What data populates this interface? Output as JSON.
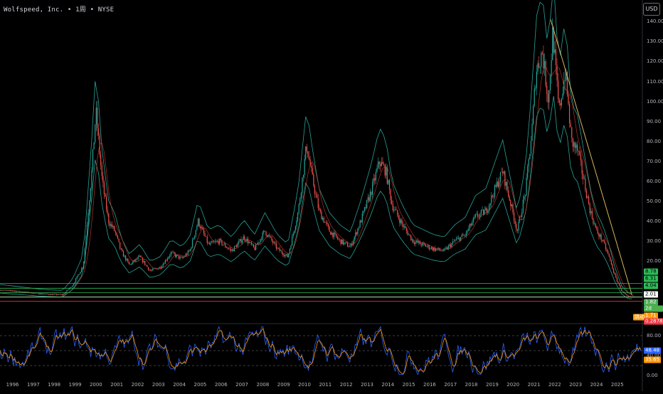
{
  "header": {
    "title": "Wolfspeed, Inc. • 1周 • NYSE",
    "currency_button": "USD"
  },
  "chart_data": [
    {
      "type": "line",
      "title": "Wolfspeed, Inc. • 1周 • NYSE",
      "price_axis": {
        "ylim": [
          -2.5,
          143
        ],
        "ticks": [
          {
            "value": 140,
            "label": "140.00"
          },
          {
            "value": 130,
            "label": "130.00"
          },
          {
            "value": 120,
            "label": "120.00"
          },
          {
            "value": 110,
            "label": "110.00"
          },
          {
            "value": 100,
            "label": "100.00"
          },
          {
            "value": 90,
            "label": "90.00"
          },
          {
            "value": 80,
            "label": "80.00"
          },
          {
            "value": 70,
            "label": "70.00"
          },
          {
            "value": 60,
            "label": "60.00"
          },
          {
            "value": 50,
            "label": "50.00"
          },
          {
            "value": 40,
            "label": "40.00"
          },
          {
            "value": 30,
            "label": "30.00"
          },
          {
            "value": 20,
            "label": "20.00"
          }
        ]
      },
      "x_axis": {
        "range": [
          1995.5,
          2026.3
        ],
        "ticks": [
          "1996",
          "1997",
          "1998",
          "1999",
          "2000",
          "2001",
          "2002",
          "2003",
          "2004",
          "2005",
          "2006",
          "2007",
          "2008",
          "2009",
          "2010",
          "2011",
          "2012",
          "2013",
          "2014",
          "2015",
          "2016",
          "2017",
          "2018",
          "2019",
          "2020",
          "2021",
          "2022",
          "2023",
          "2024",
          "2025"
        ]
      },
      "series": [
        {
          "role": "price",
          "color": "#e0707a",
          "x": [
            1995.5,
            1996.5,
            1997.5,
            1998.5,
            1999.0,
            1999.5,
            1999.9,
            2000.1,
            2000.4,
            2000.7,
            2001.0,
            2001.3,
            2001.7,
            2002.2,
            2002.7,
            2003.2,
            2003.7,
            2004.2,
            2004.6,
            2005.0,
            2005.5,
            2006.0,
            2006.6,
            2007.2,
            2007.7,
            2008.2,
            2008.8,
            2009.3,
            2009.8,
            2010.2,
            2010.5,
            2010.8,
            2011.3,
            2011.8,
            2012.3,
            2012.8,
            2013.3,
            2013.7,
            2014.0,
            2014.3,
            2014.8,
            2015.3,
            2015.8,
            2016.3,
            2016.8,
            2017.3,
            2017.8,
            2018.3,
            2018.8,
            2019.2,
            2019.6,
            2020.0,
            2020.3,
            2020.7,
            2021.0,
            2021.2,
            2021.5,
            2021.8,
            2022.0,
            2022.3,
            2022.6,
            2022.9,
            2023.2,
            2023.5,
            2023.8,
            2024.1,
            2024.4,
            2024.7,
            2025.0,
            2025.3,
            2025.6,
            2025.9
          ],
          "y": [
            5.5,
            4.5,
            3.5,
            3.0,
            8.0,
            18.0,
            65.0,
            95.0,
            60.0,
            40.0,
            35.0,
            25.0,
            18.0,
            22.0,
            15.0,
            17.0,
            24.0,
            21.0,
            25.0,
            40.0,
            28.0,
            30.0,
            25.0,
            32.0,
            26.0,
            35.0,
            26.0,
            22.0,
            45.0,
            78.0,
            60.0,
            45.0,
            35.0,
            30.0,
            27.0,
            40.0,
            55.0,
            70.0,
            65.0,
            48.0,
            38.0,
            30.0,
            28.0,
            26.0,
            25.0,
            30.0,
            33.0,
            42.0,
            45.0,
            55.0,
            65.0,
            48.0,
            35.0,
            55.0,
            85.0,
            115.0,
            125.0,
            100.0,
            135.0,
            95.0,
            115.0,
            80.0,
            75.0,
            60.0,
            45.0,
            35.0,
            30.0,
            22.0,
            12.0,
            5.0,
            2.0,
            1.8
          ]
        },
        {
          "role": "upper-band",
          "color": "#2bb3a6"
        },
        {
          "role": "lower-band",
          "color": "#2bb3a6"
        },
        {
          "role": "trendline",
          "color": "#d8b55a",
          "from": [
            2021.9,
            141
          ],
          "to": [
            2025.8,
            3
          ]
        }
      ],
      "horizontal_levels": [
        {
          "value": 8.78,
          "label": "8.78",
          "color": "#2ebd58"
        },
        {
          "value": 6.31,
          "label": "6.31",
          "color": "#2ebd58"
        },
        {
          "value": 4.04,
          "label": "4.04",
          "color": "#2ebd58"
        },
        {
          "value": 2.01,
          "label": "2.01",
          "color": "#ffffff"
        },
        {
          "value": 1.82,
          "label": "1.82",
          "color": "#4caf50"
        },
        {
          "value": -0.24,
          "label": "2d 12h",
          "color": "#4caf50"
        },
        {
          "value": -2.0,
          "label": "1.71",
          "color": "#ff9800"
        },
        {
          "value": -2.0,
          "label": "跳动",
          "color": "#ff9800"
        },
        {
          "value": -4.5,
          "label": "0.2878",
          "color": "#f23645"
        }
      ]
    },
    {
      "type": "line",
      "title": "",
      "oscillator_axis": {
        "ylim": [
          0,
          100
        ],
        "ticks": [
          {
            "value": 80,
            "label": "80.00"
          },
          {
            "value": 40,
            "label": "40.00"
          },
          {
            "value": 0,
            "label": "0.00"
          }
        ],
        "dashed_levels": [
          80,
          50,
          20
        ]
      },
      "series": [
        {
          "role": "%K",
          "color": "#2962ff",
          "last_value_label": "48.48"
        },
        {
          "role": "%D",
          "color": "#ff9800",
          "last_value_label": "35.65"
        }
      ]
    }
  ]
}
